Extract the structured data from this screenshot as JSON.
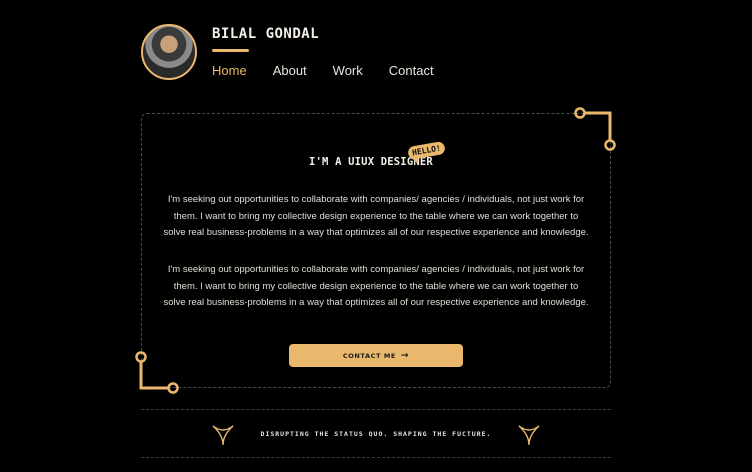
{
  "header": {
    "name": "BILAL GONDAL",
    "nav": [
      {
        "label": "Home",
        "active": true
      },
      {
        "label": "About",
        "active": false
      },
      {
        "label": "Work",
        "active": false
      },
      {
        "label": "Contact",
        "active": false
      }
    ]
  },
  "hero": {
    "title": "I'M A UIUX DESIGNER",
    "badge": "HELLO!",
    "paragraphs": [
      "I'm seeking out opportunities to collaborate with companies/ agencies / individuals, not just work for them. I want to bring my collective design experience to the table where we can work together to solve real business-problems in a way that optimizes all of our respective experience and knowledge.",
      "I'm seeking out opportunities to collaborate with companies/ agencies / individuals, not just work for them. I want to bring my collective design experience to the table where we can work together to solve real business-problems in a way that optimizes all of our respective experience and knowledge."
    ],
    "cta_label": "CONTACT ME",
    "cta_icon": "arrow-right-icon"
  },
  "footer": {
    "tagline": "DISRUPTING THE STATUS QUO. SHAPING THE FUCTURE.",
    "icon": "sparkle-icon"
  },
  "colors": {
    "accent": "#e9b86c",
    "background": "#000000",
    "text": "#e8e4dc"
  }
}
